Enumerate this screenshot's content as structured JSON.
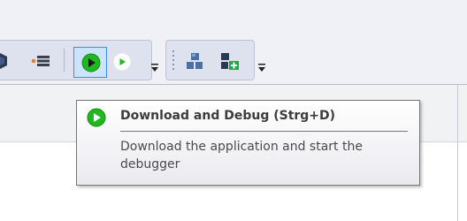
{
  "toolbar": {
    "icons": {
      "partial_left": "toolbar-icon-partial",
      "breakpoint_list": "breakpoint-list-icon",
      "download_debug": "download-debug-icon",
      "run": "run-icon",
      "dropdown": "toolbar-dropdown-icon",
      "module_view": "module-view-icon",
      "module_add": "module-add-icon"
    }
  },
  "tooltip": {
    "title": "Download and Debug (Strg+D)",
    "description": "Download the application and start the debugger",
    "icon": "download-debug-icon"
  },
  "colors": {
    "accent_green": "#1fb81f",
    "selected_border": "#3d8ee6",
    "tooltip_border": "#767676"
  }
}
